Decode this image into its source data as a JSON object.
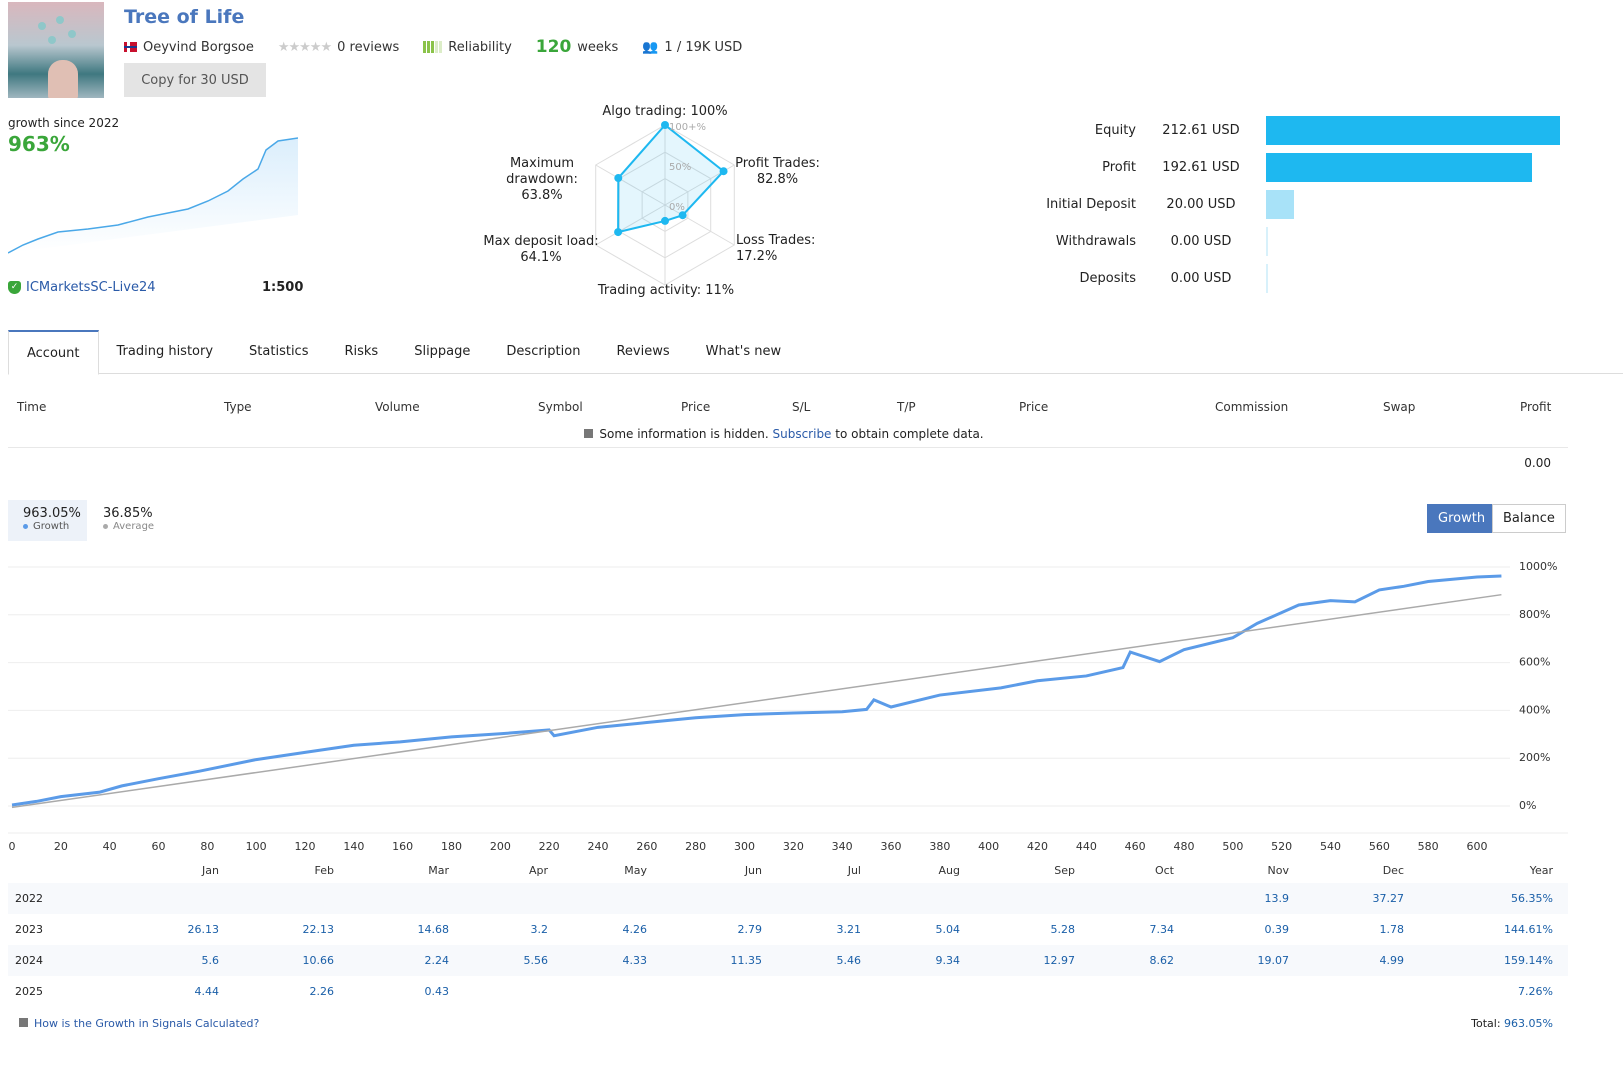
{
  "header": {
    "title": "Tree of Life",
    "author": "Oeyvind Borgsoe",
    "reviews": "0 reviews",
    "reliability": "Reliability",
    "weeks_num": "120",
    "weeks_label": "weeks",
    "subscribers": "1 / 19K USD",
    "copy_button": "Copy for 30 USD",
    "reliability_level": 0.6
  },
  "growth_summary": {
    "label": "growth since 2022",
    "value": "963%",
    "broker": "ICMarketsSC-Live24",
    "leverage": "1:500"
  },
  "radar": {
    "labels": {
      "algo": "Algo trading: 100%",
      "profit": "Profit Trades:",
      "profit_v": "82.8%",
      "loss": "Loss Trades: 17.2%",
      "activity": "Trading activity: 11%",
      "load": "Max deposit load:",
      "load_v": "64.1%",
      "dd": "Maximum",
      "dd_v": "drawdown: 63.8%"
    },
    "ticks": [
      "100+%",
      "50%",
      "0%"
    ],
    "values": {
      "algo": 100,
      "profit": 82.8,
      "loss": 17.2,
      "activity": 11,
      "load": 64.1,
      "drawdown": 63.8
    }
  },
  "finance": [
    {
      "label": "Equity",
      "value": "212.61 USD",
      "amount": 212.61
    },
    {
      "label": "Profit",
      "value": "192.61 USD",
      "amount": 192.61
    },
    {
      "label": "Initial Deposit",
      "value": "20.00 USD",
      "amount": 20
    },
    {
      "label": "Withdrawals",
      "value": "0.00 USD",
      "amount": 0
    },
    {
      "label": "Deposits",
      "value": "0.00 USD",
      "amount": 0
    }
  ],
  "tabs": [
    "Account",
    "Trading history",
    "Statistics",
    "Risks",
    "Slippage",
    "Description",
    "Reviews",
    "What's new"
  ],
  "trade_table": {
    "columns": [
      "Time",
      "Type",
      "Volume",
      "Symbol",
      "Price",
      "S/L",
      "T/P",
      "Price",
      "Commission",
      "Swap",
      "Profit"
    ],
    "hidden_pre": "Some information is hidden.",
    "hidden_link": "Subscribe",
    "hidden_post": "to obtain complete data.",
    "total": "0.00"
  },
  "stats": {
    "growth": "963.05%",
    "growth_label": "Growth",
    "average": "36.85%",
    "average_label": "Average"
  },
  "chart_buttons": {
    "growth": "Growth",
    "balance": "Balance"
  },
  "chart_data": {
    "type": "line",
    "xlim": [
      0,
      610
    ],
    "ylim": [
      -50,
      1050
    ],
    "x_ticks": [
      "0",
      "20",
      "40",
      "60",
      "80",
      "100",
      "120",
      "140",
      "160",
      "180",
      "200",
      "220",
      "240",
      "260",
      "280",
      "300",
      "320",
      "340",
      "360",
      "380",
      "400",
      "420",
      "440",
      "460",
      "480",
      "500",
      "520",
      "540",
      "560",
      "580",
      "600"
    ],
    "y_ticks": [
      "1000%",
      "800%",
      "600%",
      "400%",
      "200%",
      "0%"
    ],
    "grid": true,
    "colors": {
      "growth": "#5b9be8",
      "average": "#aaaaaa"
    },
    "series": [
      {
        "name": "Growth",
        "x": [
          0,
          10,
          20,
          36,
          45,
          60,
          77,
          100,
          120,
          140,
          159,
          180,
          200,
          220,
          222,
          240,
          260,
          280,
          300,
          320,
          340,
          350,
          353,
          360,
          380,
          405,
          420,
          440,
          455,
          458,
          470,
          480,
          500,
          510,
          527,
          540,
          550,
          560,
          570,
          580,
          600,
          610
        ],
        "y": [
          0,
          15,
          35,
          54,
          80,
          110,
          142,
          190,
          220,
          250,
          264,
          285,
          298,
          314,
          290,
          325,
          345,
          365,
          378,
          385,
          390,
          400,
          440,
          410,
          460,
          490,
          520,
          540,
          575,
          640,
          600,
          650,
          700,
          760,
          837,
          855,
          850,
          900,
          915,
          935,
          954,
          958
        ]
      },
      {
        "name": "Average",
        "x": [
          0,
          610
        ],
        "y": [
          -10,
          880
        ]
      }
    ]
  },
  "monthly": {
    "headers": [
      "Jan",
      "Feb",
      "Mar",
      "Apr",
      "May",
      "Jun",
      "Jul",
      "Aug",
      "Sep",
      "Oct",
      "Nov",
      "Dec",
      "Year"
    ],
    "rows": [
      {
        "year": "2022",
        "values": [
          "",
          "",
          "",
          "",
          "",
          "",
          "",
          "",
          "",
          "",
          "13.9",
          "37.27",
          "56.35%"
        ]
      },
      {
        "year": "2023",
        "values": [
          "26.13",
          "22.13",
          "14.68",
          "3.2",
          "4.26",
          "2.79",
          "3.21",
          "5.04",
          "5.28",
          "7.34",
          "0.39",
          "1.78",
          "144.61%"
        ]
      },
      {
        "year": "2024",
        "values": [
          "5.6",
          "10.66",
          "2.24",
          "5.56",
          "4.33",
          "11.35",
          "5.46",
          "9.34",
          "12.97",
          "8.62",
          "19.07",
          "4.99",
          "159.14%"
        ]
      },
      {
        "year": "2025",
        "values": [
          "4.44",
          "2.26",
          "0.43",
          "",
          "",
          "",
          "",
          "",
          "",
          "",
          "",
          "",
          "7.26%"
        ]
      }
    ]
  },
  "footer": {
    "link": "How is the Growth in Signals Calculated?",
    "total_label": "Total:",
    "total_value": "963.05%"
  }
}
